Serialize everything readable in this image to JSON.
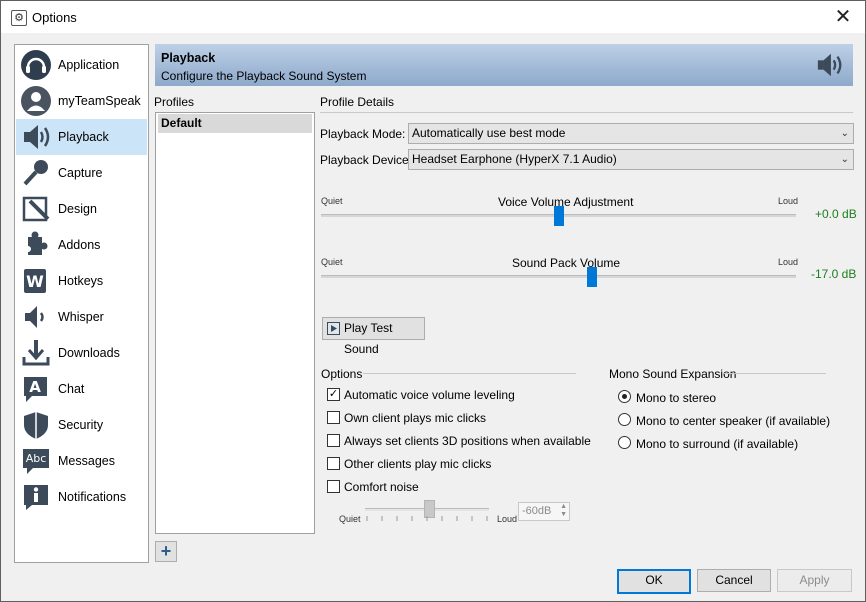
{
  "window": {
    "title": "Options",
    "close_glyph": "✕"
  },
  "sidebar": {
    "items": [
      {
        "label": "Application",
        "icon": "headset-icon",
        "active": false
      },
      {
        "label": "myTeamSpeak",
        "icon": "user-icon",
        "active": false
      },
      {
        "label": "Playback",
        "icon": "speaker-icon",
        "active": true
      },
      {
        "label": "Capture",
        "icon": "microphone-icon",
        "active": false
      },
      {
        "label": "Design",
        "icon": "pencil-icon",
        "active": false
      },
      {
        "label": "Addons",
        "icon": "puzzle-icon",
        "active": false
      },
      {
        "label": "Hotkeys",
        "icon": "keyboard-icon",
        "active": false
      },
      {
        "label": "Whisper",
        "icon": "whisper-speaker-icon",
        "active": false
      },
      {
        "label": "Downloads",
        "icon": "download-icon",
        "active": false
      },
      {
        "label": "Chat",
        "icon": "chat-icon",
        "active": false
      },
      {
        "label": "Security",
        "icon": "shield-icon",
        "active": false
      },
      {
        "label": "Messages",
        "icon": "messages-icon",
        "active": false
      },
      {
        "label": "Notifications",
        "icon": "info-icon",
        "active": false
      }
    ]
  },
  "header": {
    "title": "Playback",
    "subtitle": "Configure the Playback Sound System"
  },
  "profiles": {
    "heading": "Profiles",
    "items": [
      "Default"
    ],
    "selected": "Default",
    "add_glyph": "+"
  },
  "details": {
    "heading": "Profile Details",
    "playback_mode": {
      "label": "Playback Mode:",
      "value": "Automatically use best mode"
    },
    "playback_device": {
      "label": "Playback Device:",
      "value": "Headset Earphone (HyperX 7.1 Audio)"
    },
    "voice_volume": {
      "title": "Voice Volume Adjustment",
      "min_label": "Quiet",
      "max_label": "Loud",
      "value_text": "+0.0 dB",
      "position_fraction": 0.5
    },
    "sound_pack": {
      "title": "Sound Pack Volume",
      "min_label": "Quiet",
      "max_label": "Loud",
      "value_text": "-17.0 dB",
      "position_fraction": 0.57
    },
    "play_test_button": "Play Test Sound"
  },
  "options": {
    "heading": "Options",
    "checkboxes": [
      {
        "label": "Automatic voice volume leveling",
        "checked": true
      },
      {
        "label": "Own client plays mic clicks",
        "checked": false
      },
      {
        "label": "Always set clients 3D positions when available",
        "checked": false
      },
      {
        "label": "Other clients play mic clicks",
        "checked": false
      },
      {
        "label": "Comfort noise",
        "checked": false
      }
    ],
    "comfort_noise": {
      "min_label": "Quiet",
      "max_label": "Loud",
      "value": "-60dB"
    }
  },
  "mono": {
    "heading": "Mono Sound Expansion",
    "radios": [
      {
        "label": "Mono to stereo",
        "selected": true
      },
      {
        "label": "Mono to center speaker (if available)",
        "selected": false
      },
      {
        "label": "Mono to surround (if available)",
        "selected": false
      }
    ]
  },
  "footer": {
    "ok": "OK",
    "cancel": "Cancel",
    "apply": "Apply"
  },
  "colors": {
    "accent": "#0078d7",
    "active_item": "#cce4f7",
    "positive": "#1e7e1e"
  }
}
